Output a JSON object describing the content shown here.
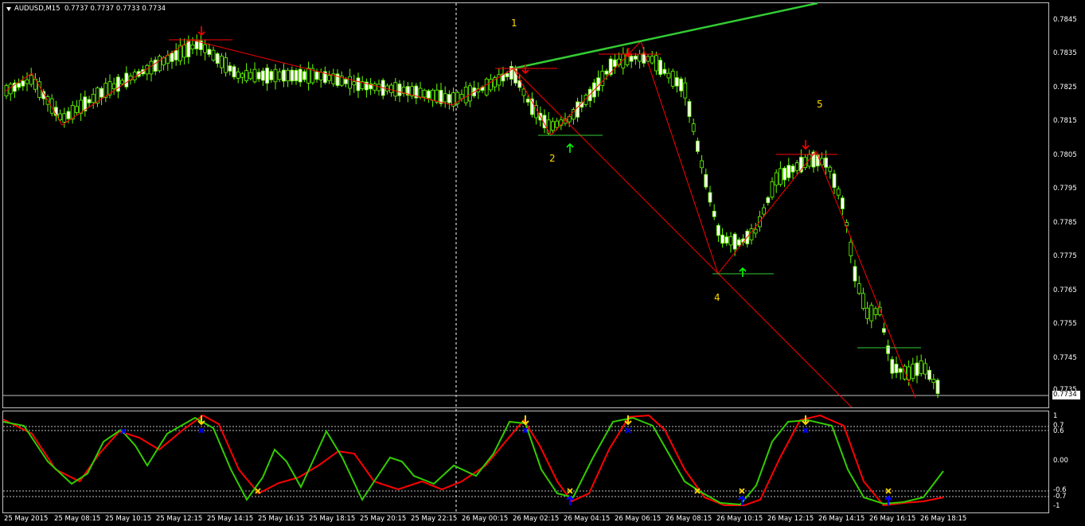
{
  "header": {
    "symbol_info": "AUDUSD,M15",
    "ohlc": "0.7737 0.7737 0.7733 0.7734"
  },
  "price_axis": {
    "labels": [
      "0.7845",
      "0.7835",
      "0.7825",
      "0.7815",
      "0.7805",
      "0.7795",
      "0.7785",
      "0.7775",
      "0.7765",
      "0.7755",
      "0.7745",
      "0.7735"
    ],
    "current_price": "0.7734"
  },
  "osc_axis": {
    "labels": [
      "1",
      "0.7",
      "0.6",
      "0.00",
      "-0.6",
      "-0.7",
      "-1"
    ]
  },
  "time_axis": {
    "labels": [
      "25 May 2015",
      "25 May 08:15",
      "25 May 10:15",
      "25 May 12:15",
      "25 May 14:15",
      "25 May 16:15",
      "25 May 18:15",
      "25 May 20:15",
      "25 May 22:15",
      "26 May 00:15",
      "26 May 02:15",
      "26 May 04:15",
      "26 May 06:15",
      "26 May 08:15",
      "26 May 10:15",
      "26 May 12:15",
      "26 May 14:15",
      "26 May 16:15",
      "26 May 18:15"
    ]
  },
  "wave_labels": [
    "1",
    "2",
    "4",
    "5"
  ],
  "colors": {
    "bull_candle": "#ffffff",
    "bear_candle": "#000000",
    "wick": "#66ff00",
    "zigzag": "#ff0000",
    "trendline": "#33cc33",
    "osc_fast": "#33cc00",
    "osc_slow": "#ff0000",
    "sell_arrow": "#ff0000",
    "buy_arrow": "#00ff00",
    "osc_signal_arrow": "#ffd700",
    "osc_cross": "#ffd700",
    "osc_buy_arrow": "#0000ff"
  }
}
